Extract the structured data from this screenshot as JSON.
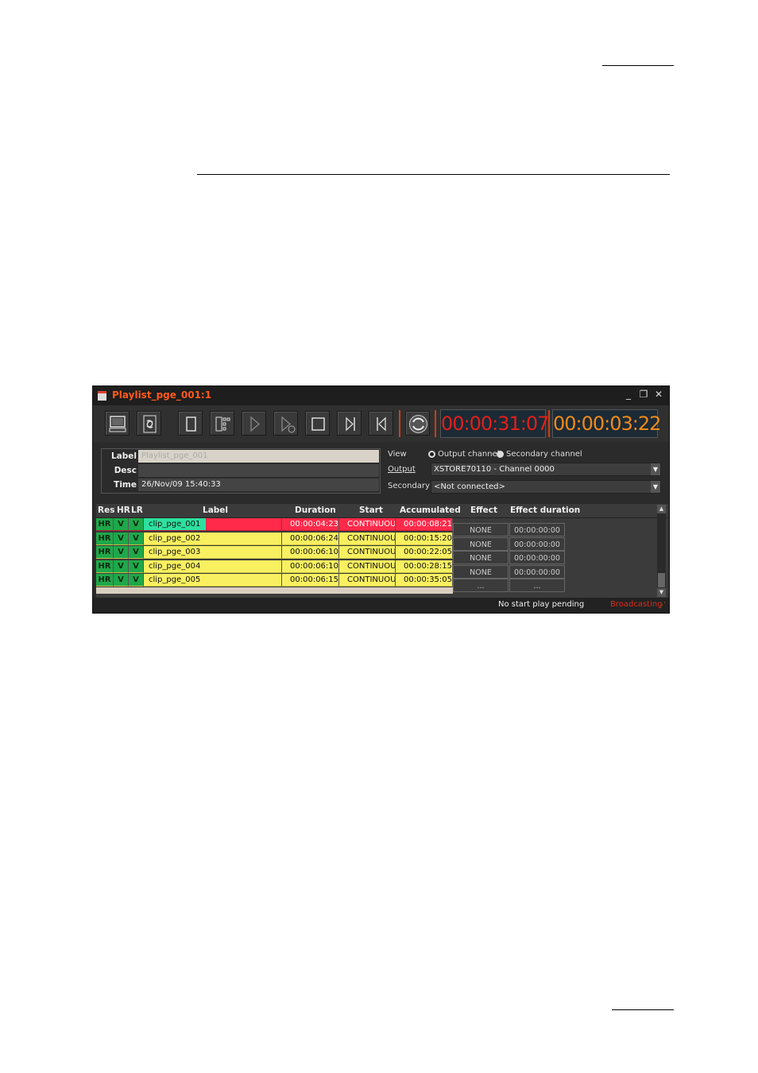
{
  "window": {
    "title": "Playlist_pge_001:1",
    "minimize": "_",
    "maximize": "❐",
    "close": "✕"
  },
  "timers": {
    "elapsed": "00:00:31:07",
    "remaining": "00:00:03:22",
    "elapsed_color": "#e0201a",
    "remaining_color": "#f08a1a"
  },
  "info": {
    "label_caption": "Label",
    "desc_caption": "Desc",
    "time_caption": "Time",
    "label_value": "Playlist_pge_001",
    "desc_value": "",
    "time_value": "26/Nov/09 15:40:33"
  },
  "view": {
    "view_label": "View",
    "output_channel": "Output channel",
    "secondary_channel": "Secondary channel",
    "output_label": "Output",
    "output_value": "XSTORE70110 - Channel 0000",
    "secondary_label": "Secondary",
    "secondary_value": "<Not connected>"
  },
  "grid": {
    "headers": [
      "Res",
      "HR",
      "LR",
      "Label",
      "Duration",
      "Start",
      "Accumulated",
      "Effect",
      "Effect duration"
    ],
    "rows": [
      {
        "res": "HR",
        "hr": "V",
        "lr": "V",
        "label": "clip_pge_001",
        "duration": "00:00:04:23",
        "start": "CONTINUOUS",
        "accumulated": "00:00:08:21"
      },
      {
        "res": "HR",
        "hr": "V",
        "lr": "V",
        "label": "clip_pge_002",
        "duration": "00:00:06:24",
        "start": "CONTINUOUS",
        "accumulated": "00:00:15:20"
      },
      {
        "res": "HR",
        "hr": "V",
        "lr": "V",
        "label": "clip_pge_003",
        "duration": "00:00:06:10",
        "start": "CONTINUOUS",
        "accumulated": "00:00:22:05"
      },
      {
        "res": "HR",
        "hr": "V",
        "lr": "V",
        "label": "clip_pge_004",
        "duration": "00:00:06:10",
        "start": "CONTINUOUS",
        "accumulated": "00:00:28:15"
      },
      {
        "res": "HR",
        "hr": "V",
        "lr": "V",
        "label": "clip_pge_005",
        "duration": "00:00:06:15",
        "start": "CONTINUOUS",
        "accumulated": "00:00:35:05"
      }
    ],
    "effects": [
      {
        "effect": "NONE",
        "duration": "00:00:00:00"
      },
      {
        "effect": "NONE",
        "duration": "00:00:00:00"
      },
      {
        "effect": "NONE",
        "duration": "00:00:00:00"
      },
      {
        "effect": "NONE",
        "duration": "00:00:00:00"
      },
      {
        "effect": "...",
        "duration": "..."
      }
    ],
    "colors": {
      "playing": "#ff2a4a",
      "current_label": "#2ee0a0",
      "queued": "#f8f060",
      "res_bg": "#1fa84a"
    }
  },
  "status": {
    "message": "No start play pending",
    "state": "Broadcasting",
    "state_color": "#e02a1a"
  }
}
